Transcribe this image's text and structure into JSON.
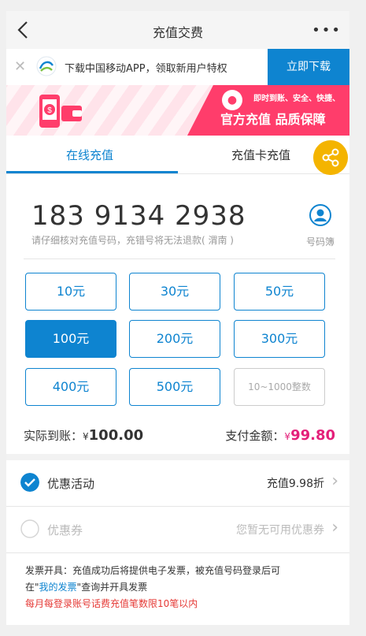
{
  "header": {
    "title": "充值交费",
    "more": "•••"
  },
  "app_banner": {
    "text": "下载中国移动APP，领取新用户特权",
    "download": "立即下载"
  },
  "promo": {
    "subtitle": "即时到账、安全、快捷、",
    "main": "官方充值 品质保障"
  },
  "tabs": [
    {
      "label": "在线充值",
      "active": true
    },
    {
      "label": "充值卡充值",
      "active": false
    }
  ],
  "phone": {
    "number": "183 9134 2938",
    "hint": "请仔细核对充值号码，充错号将无法退款( 渭南 )",
    "contacts": "号码簿"
  },
  "amounts": [
    "10元",
    "30元",
    "50元",
    "100元",
    "200元",
    "300元",
    "400元",
    "500元"
  ],
  "custom_amount_placeholder": "10~1000整数",
  "selected_amount": "100元",
  "totals": {
    "arrival_label": "实际到账：",
    "arrival_currency": "¥",
    "arrival_value": "100.00",
    "pay_label": "支付金额：",
    "pay_currency": "¥",
    "pay_value": "99.80"
  },
  "promotion": {
    "label": "优惠活动",
    "value": "充值9.98折"
  },
  "coupon": {
    "label": "优惠券",
    "value": "您暂无可用优惠券"
  },
  "notes": {
    "invoice_1": "发票开具：充值成功后将提供电子发票，被充值号码登录后可",
    "invoice_2a": "在\"",
    "invoice_link": "我的发票",
    "invoice_2b": "\"查询并开具发票",
    "limit": "每月每登录账号话费充值笔数限10笔以内"
  },
  "colors": {
    "primary": "#0e84d0",
    "pink": "#e4207a",
    "banner": "#ff3d6b",
    "share": "#f4b400",
    "warning": "#e53935"
  }
}
